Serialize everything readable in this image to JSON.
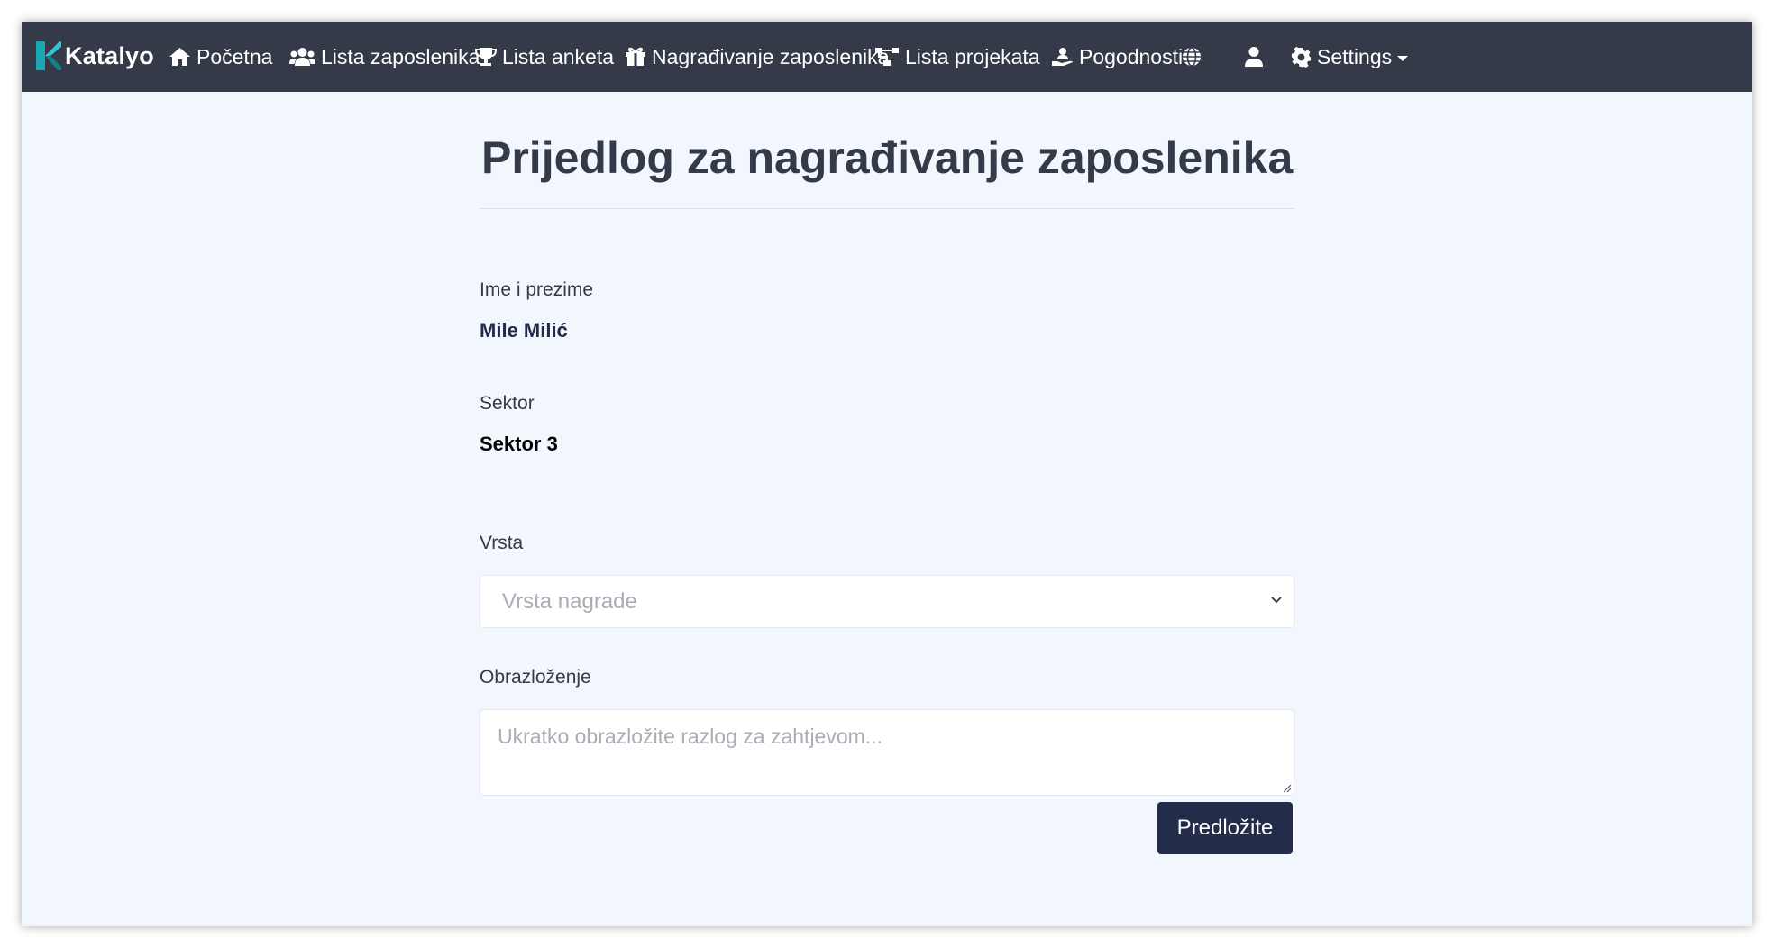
{
  "navbar": {
    "brand": "Katalyo",
    "items": [
      {
        "label": "Početna",
        "icon": "home-icon"
      },
      {
        "label": "Lista zaposlenika",
        "icon": "users-icon"
      },
      {
        "label": "Lista anketa",
        "icon": "trophy-icon"
      },
      {
        "label": "Nagrađivanje zaposlenika",
        "icon": "gift-icon"
      },
      {
        "label": "Lista projekata",
        "icon": "sitemap-icon"
      },
      {
        "label": "Pogodnosti",
        "icon": "hand-holding-user-icon"
      }
    ],
    "language_icon": "globe-icon",
    "user_icon": "user-icon",
    "settings_label": "Settings",
    "settings_icon": "gear-icon"
  },
  "page": {
    "title": "Prijedlog za nagrađivanje zaposlenika"
  },
  "form": {
    "name_label": "Ime i prezime",
    "name_value": "Mile Milić",
    "sector_label": "Sektor",
    "sector_value": "Sektor 3",
    "type_label": "Vrsta",
    "type_placeholder": "Vrsta nagrade",
    "reason_label": "Obrazloženje",
    "reason_placeholder": "Ukratko obrazložite razlog za zahtjevom...",
    "submit_label": "Predložite"
  },
  "colors": {
    "navbar_bg": "#343a48",
    "page_bg": "#f2f6fd",
    "button_bg": "#232c49",
    "brand_accent": "#1fb6c1"
  }
}
